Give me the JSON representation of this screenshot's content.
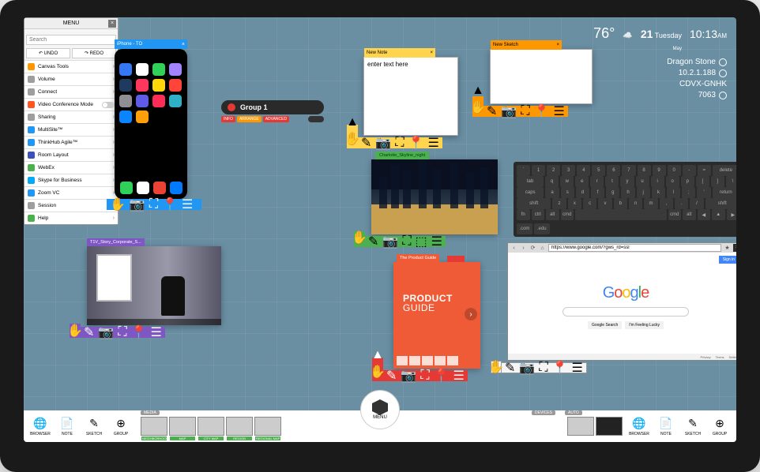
{
  "status": {
    "temp": "76°",
    "date_day": "21",
    "date_label": "Tuesday",
    "date_month": "May",
    "time": "10:13",
    "time_suffix": "AM",
    "user": "Dragon Stone",
    "ip": "10.2.1.188",
    "device_id": "CDVX-GNHK",
    "code": "7063"
  },
  "phone": {
    "title": "iPhone - TO"
  },
  "group": {
    "title": "Group 1",
    "badges": [
      {
        "label": "INFO",
        "color": "#e53935"
      },
      {
        "label": "ARRANGE",
        "color": "#ff9800"
      },
      {
        "label": "ADVANCED",
        "color": "#e53935"
      }
    ]
  },
  "note": {
    "tab": "New Note",
    "text": "enter text here"
  },
  "sketch": {
    "tab": "New Sketch"
  },
  "image": {
    "title": "Charlotte_Skyline_night"
  },
  "video": {
    "title": "T1V_Story_Corporate_S..."
  },
  "menu": {
    "title": "MENU",
    "search_placeholder": "Search",
    "undo": "UNDO",
    "redo": "REDO",
    "items": [
      {
        "label": "Canvas Tools",
        "color": "#ff9800"
      },
      {
        "label": "Volume",
        "color": "#9e9e9e"
      },
      {
        "label": "Connect",
        "color": "#9e9e9e"
      },
      {
        "label": "Video Conference Mode",
        "color": "#ff5722",
        "toggle": true
      },
      {
        "label": "Sharing",
        "color": "#9e9e9e"
      },
      {
        "label": "MultiSite™",
        "color": "#2196f3"
      },
      {
        "label": "ThinkHub Agile™",
        "color": "#2196f3"
      },
      {
        "label": "Room Layout",
        "color": "#3f51b5"
      },
      {
        "label": "WebEx",
        "color": "#4caf50"
      },
      {
        "label": "Skype for Business",
        "color": "#03a9f4"
      },
      {
        "label": "Zoom VC",
        "color": "#2196f3"
      },
      {
        "label": "Session",
        "color": "#9e9e9e"
      },
      {
        "label": "Help",
        "color": "#4caf50"
      }
    ]
  },
  "pguide": {
    "tab": "The Product Guide",
    "line1": "PRODUCT",
    "line2": "GUIDE"
  },
  "keyboard": {
    "rows": [
      [
        "`",
        "1",
        "2",
        "3",
        "4",
        "5",
        "6",
        "7",
        "8",
        "9",
        "0",
        "-",
        "=",
        "delete"
      ],
      [
        "tab",
        "q",
        "w",
        "e",
        "r",
        "t",
        "y",
        "u",
        "i",
        "o",
        "p",
        "[",
        "]",
        "\\"
      ],
      [
        "caps",
        "a",
        "s",
        "d",
        "f",
        "g",
        "h",
        "j",
        "k",
        "l",
        ";",
        "'",
        "return"
      ],
      [
        "shift",
        "z",
        "x",
        "c",
        "v",
        "b",
        "n",
        "m",
        ",",
        ".",
        "/",
        "shift"
      ],
      [
        "fn",
        "ctrl",
        "alt",
        "cmd",
        "",
        "cmd",
        "alt",
        "◀",
        "▲",
        "▶"
      ]
    ],
    "extra": [
      ".com",
      ".edu"
    ]
  },
  "browser": {
    "url": "https://www.google.com/?gws_rd=ssl",
    "signin": "Sign in",
    "btn1": "Google Search",
    "btn2": "I'm Feeling Lucky",
    "foot": [
      "Privacy",
      "Terms",
      "Settings"
    ]
  },
  "bottombar": {
    "tools": [
      {
        "label": "BROWSER",
        "icon": "🌐"
      },
      {
        "label": "NOTE",
        "icon": "📄"
      },
      {
        "label": "SKETCH",
        "icon": "✎"
      },
      {
        "label": "GROUP",
        "icon": "⊕"
      }
    ],
    "section_media": "MEDIA",
    "section_devices": "DEVICES",
    "section_auto": "AUTO",
    "media": [
      {
        "label": "NEIGHBORHOOD"
      },
      {
        "label": "MAP"
      },
      {
        "label": "CITY MAP"
      },
      {
        "label": "REGION"
      },
      {
        "label": "REGIONAL MAP"
      }
    ],
    "menu_label": "MENU"
  }
}
